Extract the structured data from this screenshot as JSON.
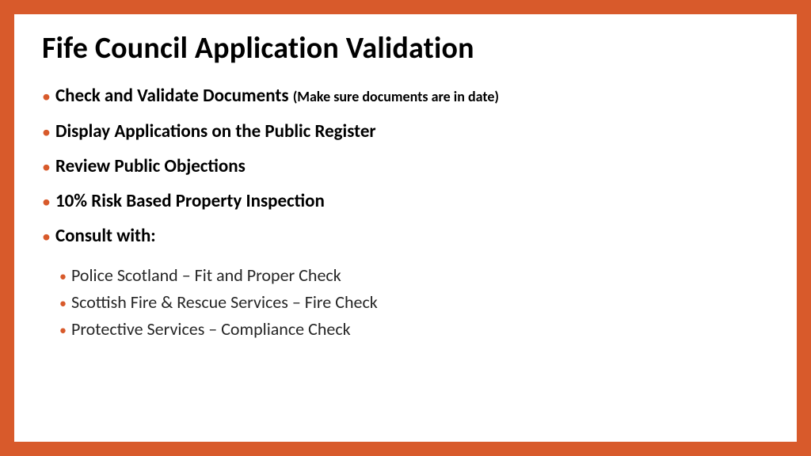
{
  "colors": {
    "frame": "#d85a2b",
    "text": "#000000",
    "subtext": "#262626"
  },
  "title": "Fife Council Application Validation",
  "items": [
    {
      "text": "Check and Validate Documents ",
      "note": "(Make sure documents are in date)"
    },
    {
      "text": "Display Applications on the Public Register"
    },
    {
      "text": "Review Public Objections"
    },
    {
      "text": "10% Risk Based Property Inspection"
    },
    {
      "text": "Consult with:"
    }
  ],
  "subitems": [
    "Police Scotland – Fit and Proper Check",
    "Scottish Fire & Rescue Services – Fire Check",
    "Protective Services – Compliance Check"
  ]
}
